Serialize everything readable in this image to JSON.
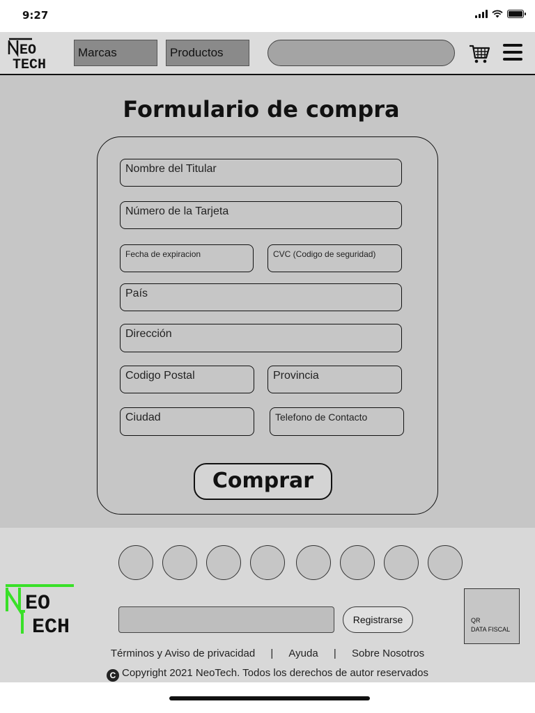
{
  "status_bar": {
    "time": "9:27",
    "icons": [
      "signal-icon",
      "wifi-icon",
      "battery-icon"
    ]
  },
  "header": {
    "logo_text": [
      "N",
      "EO",
      "TECH"
    ],
    "nav": [
      {
        "label": "Marcas"
      },
      {
        "label": "Productos"
      }
    ],
    "search": {
      "placeholder": "",
      "value": ""
    },
    "icons": [
      "cart-icon",
      "menu-icon"
    ]
  },
  "main": {
    "title": "Formulario de compra",
    "fields": {
      "nombre": "Nombre del Titular",
      "tarjeta": "Número de la Tarjeta",
      "fecha": "Fecha de expiracion",
      "cvc": "CVC (Codigo de seguridad)",
      "pais": "País",
      "direccion": "Dirección",
      "postal": "Codigo Postal",
      "provincia": "Provincia",
      "ciudad": "Ciudad",
      "telefono": "Telefono de Contacto"
    },
    "submit_label": "Comprar"
  },
  "footer": {
    "social_count": 8,
    "logo_color": "#39e028",
    "newsletter": {
      "value": ""
    },
    "register_label": "Registrarse",
    "qr": {
      "line1": "QR",
      "line2": "DATA FISCAL"
    },
    "links": [
      "Términos y Aviso de privacidad",
      "|",
      "Ayuda",
      "|",
      "Sobre Nosotros"
    ],
    "copyright_symbol": "C",
    "copyright": "Copyright 2021 NeoTech. Todos los derechos de autor reservados"
  },
  "colors": {
    "header_bg": "#dcdcdc",
    "main_bg": "#c6c6c6",
    "nav_button": "#8a8a8a",
    "footer_logo": "#39e028"
  }
}
